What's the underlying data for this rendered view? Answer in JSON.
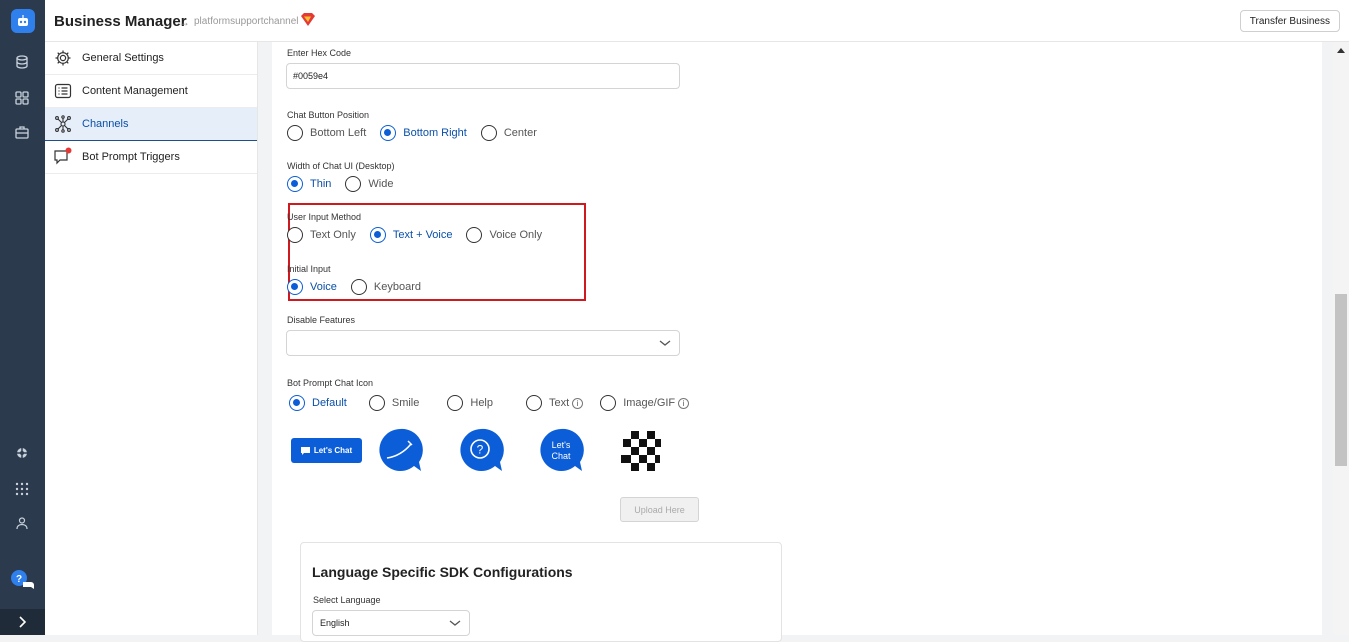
{
  "header": {
    "title": "Business Manager",
    "arrow": "→",
    "breadcrumb": "platformsupportchannel",
    "transfer_label": "Transfer Business"
  },
  "sidebar": {
    "items": [
      {
        "label": "General Settings",
        "icon": "gear-icon"
      },
      {
        "label": "Content Management",
        "icon": "list-icon"
      },
      {
        "label": "Channels",
        "icon": "network-icon",
        "active": true
      },
      {
        "label": "Bot Prompt Triggers",
        "icon": "chat-alert-icon"
      }
    ]
  },
  "form": {
    "hex_label": "Enter Hex Code",
    "hex_value": "#0059e4",
    "position_label": "Chat Button Position",
    "position_options": [
      "Bottom Left",
      "Bottom Right",
      "Center"
    ],
    "position_selected": "Bottom Right",
    "width_label": "Width of Chat UI (Desktop)",
    "width_options": [
      "Thin",
      "Wide"
    ],
    "width_selected": "Thin",
    "input_method_label": "User Input Method",
    "input_method_options": [
      "Text Only",
      "Text + Voice",
      "Voice Only"
    ],
    "input_method_selected": "Text + Voice",
    "initial_input_label": "Initial Input",
    "initial_input_options": [
      "Voice",
      "Keyboard"
    ],
    "initial_input_selected": "Voice",
    "disable_label": "Disable Features",
    "disable_value": "",
    "prompt_icon_label": "Bot Prompt Chat Icon",
    "prompt_icon_options": [
      "Default",
      "Smile",
      "Help",
      "Text",
      "Image/GIF"
    ],
    "prompt_icon_selected": "Default",
    "lets_chat_pill": "Let's Chat",
    "lets_chat_bubble_line1": "Let's",
    "lets_chat_bubble_line2": "Chat",
    "upload_label": "Upload Here"
  },
  "language_card": {
    "title": "Language Specific SDK Configurations",
    "select_label": "Select Language",
    "select_value": "English"
  },
  "colors": {
    "accent": "#0059e4",
    "rail": "#2b3a4c",
    "highlight_box": "#d0191e",
    "active_bg": "#e6eef9"
  }
}
